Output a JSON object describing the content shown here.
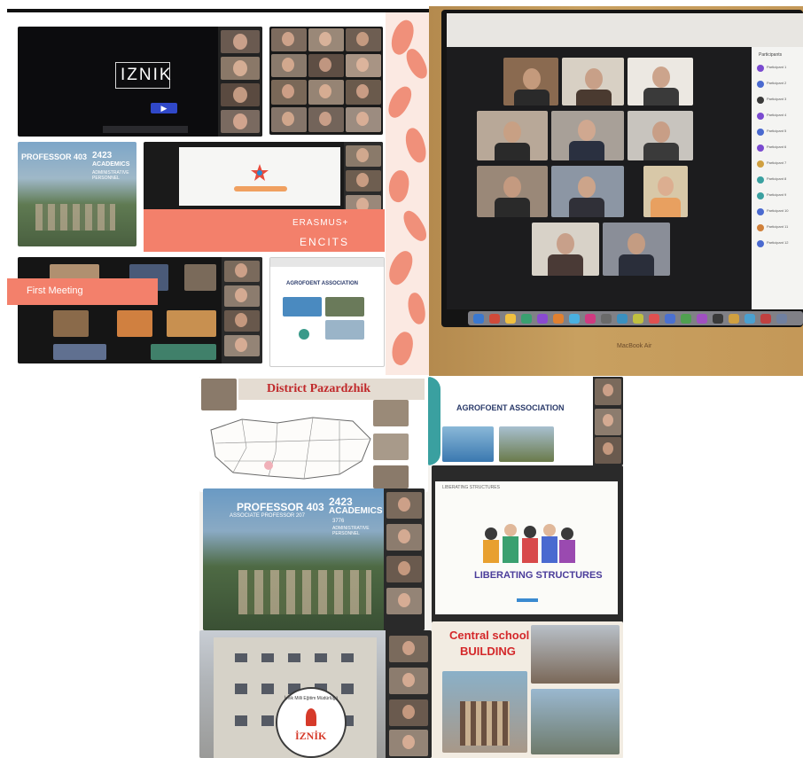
{
  "top_left": {
    "iznik_brand": "IZNIK",
    "iznik_button": "▶",
    "professor_count": "PROFESSOR 403",
    "academic_count": "2423",
    "academic_label": "ACADEMICS",
    "admin_label": "ADMINISTRATIVE PERSONNEL",
    "erasmus_label": "ERASMUS+",
    "encits_label": "ENCITS",
    "first_meeting_label": "First Meeting",
    "agrofoent_title": "AGROFOENT ASSOCIATION"
  },
  "top_right": {
    "laptop_label": "MacBook Air",
    "participants_header": "Participants",
    "participants": [
      "Participant 1",
      "Participant 2",
      "Participant 3",
      "Participant 4",
      "Participant 5",
      "Participant 6",
      "Participant 7",
      "Participant 8",
      "Participant 9",
      "Participant 10",
      "Participant 11",
      "Participant 12"
    ]
  },
  "bottom": {
    "district_title": "District Pazardzhik",
    "agrofoent_title": "AGROFOENT ASSOCIATION",
    "professor_label": "PROFESSOR 403",
    "assoc_professor_label": "ASSOCIATE PROFESSOR 207",
    "academic_count": "2423",
    "academic_label": "ACADEMICS",
    "staff_label": "3776",
    "admin_label": "ADMINISTRATIVE PERSONNEL",
    "liberating_small": "LIBERATING STRUCTURES",
    "liberating_title": "LIBERATING STRUCTURES",
    "central_school_title": "Central school",
    "building_title": "BUILDING",
    "iznik_seal_text": "İznik Milli Eğitim Müdürlüğü",
    "iznik_seal_name": "İZNİK"
  },
  "colors": {
    "accent_coral": "#f3806b",
    "zoom_dark": "#1e1e22",
    "district_red": "#c0282a",
    "liberating_purple": "#4a3c9a",
    "central_red": "#d4282a"
  }
}
